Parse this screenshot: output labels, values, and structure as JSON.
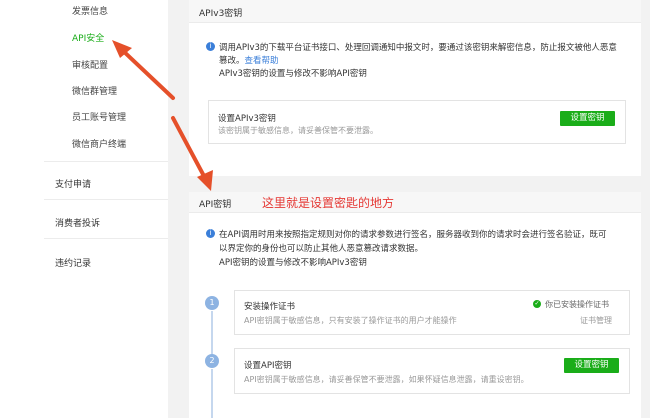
{
  "sidebar": {
    "items": [
      {
        "label": "发票信息"
      },
      {
        "label": "API安全"
      },
      {
        "label": "审核配置"
      },
      {
        "label": "微信群管理"
      },
      {
        "label": "员工账号管理"
      },
      {
        "label": "微信商户终端"
      }
    ],
    "groups": [
      {
        "label": "支付申请"
      },
      {
        "label": "消费者投诉"
      },
      {
        "label": "违约记录"
      }
    ]
  },
  "apiv3": {
    "title": "APIv3密钥",
    "notice_line1": "调用APIv3的下载平台证书接口、处理回调通知中报文时，要通过该密钥来解密信息，防止报文被他人恶意",
    "notice_line2_prefix": "篡改。",
    "help_link": "查看帮助",
    "notice_line3": "APIv3密钥的设置与修改不影响API密钥",
    "set_title": "设置APIv3密钥",
    "set_desc": "该密钥属于敏感信息，请妥善保管不要泄露。",
    "set_button": "设置密钥"
  },
  "apikey": {
    "title": "API密钥",
    "annotation": "这里就是设置密匙的地方",
    "notice_line1": "在API调用时用来按照指定规则对你的请求参数进行签名，服务器收到你的请求时会进行签名验证，既可",
    "notice_line2": "以界定你的身份也可以防止其他人恶意篡改请求数据。",
    "notice_line3": "API密钥的设置与修改不影响APIv3密钥",
    "steps": [
      {
        "number": "1",
        "title": "安装操作证书",
        "desc": "API密钥属于敏感信息，只有安装了操作证书的用户才能操作",
        "status": "你已安装操作证书",
        "link": "证书管理"
      },
      {
        "number": "2",
        "title": "设置API密钥",
        "desc": "API密钥属于敏感信息，请妥善保管不要泄露，如果怀疑信息泄露，请重设密钥。",
        "button": "设置密钥"
      }
    ]
  },
  "colors": {
    "accent_green": "#1aad19",
    "link_blue": "#3b7fd9",
    "annotation_red": "#e53935"
  }
}
